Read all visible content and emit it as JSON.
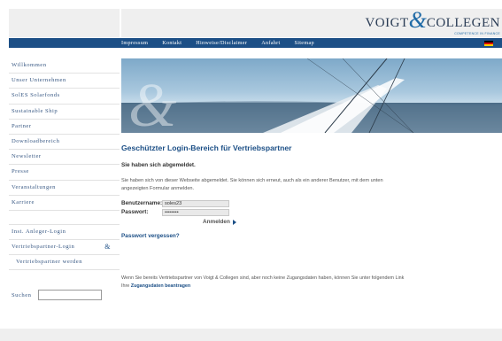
{
  "brand": {
    "logo_left": "VOIGT",
    "logo_amp": "&",
    "logo_right": "COLLEGEN",
    "tagline": "COMPETENCE IN FINANCE"
  },
  "nav": {
    "items": [
      "Impressum",
      "Kontakt",
      "Hinweise/Disclaimer",
      "Anfahrt",
      "Sitemap"
    ]
  },
  "sidebar": {
    "items": [
      "Willkommen",
      "Unser Unternehmen",
      "SolES Solarfonds",
      "Sustainable Ship",
      "Partner",
      "Downloadbereich",
      "Newsletter",
      "Presse",
      "Veranstaltungen",
      "Karriere"
    ],
    "secondary": [
      "Inst. Anleger-Login",
      "Vertriebspartner-Login",
      "Vertriebspartner werden"
    ],
    "amp": "&"
  },
  "search": {
    "label": "Suchen",
    "placeholder": ""
  },
  "main": {
    "title": "Geschützter Login-Bereich für Vertriebspartner",
    "subtitle": "Sie haben sich abgemeldet.",
    "message": "Sie haben sich von dieser Webseite abgemeldet. Sie können sich erneut, auch als ein anderer Benutzer, mit dem unten angezeigten Formular anmelden.",
    "username_label": "Benutzername:",
    "username_value": "soles23",
    "password_label": "Passwort:",
    "password_value": "••••••••",
    "login_label": "Anmelden",
    "forgot_label": "Passwort vergessen?",
    "note_text": "Wenn Sie bereits Vertriebspartner von Voigt & Collegen sind, aber noch keine Zugangsdaten haben, können Sie unter folgendem Link Ihre",
    "note_link": "Zugangsdaten beantragen"
  },
  "colors": {
    "accent": "#1c4f86",
    "link": "#3a5a85"
  }
}
